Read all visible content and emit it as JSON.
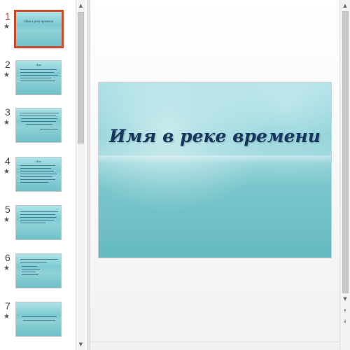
{
  "slides": [
    {
      "number": "1",
      "title": "Имя в реке времени"
    },
    {
      "number": "2",
      "title": "Цели"
    },
    {
      "number": "3",
      "title": ""
    },
    {
      "number": "4",
      "title": "Цели"
    },
    {
      "number": "5",
      "title": ""
    },
    {
      "number": "6",
      "title": ""
    },
    {
      "number": "7",
      "title": ""
    }
  ],
  "main_slide": {
    "title": "Имя в реке времени"
  },
  "icons": {
    "star": "★",
    "up": "▲",
    "down": "▼",
    "prev": "⯭",
    "next": "⯯"
  },
  "colors": {
    "selection": "#d04a2e",
    "title_text": "#17375e",
    "slide_bg": "#84cfd5"
  }
}
